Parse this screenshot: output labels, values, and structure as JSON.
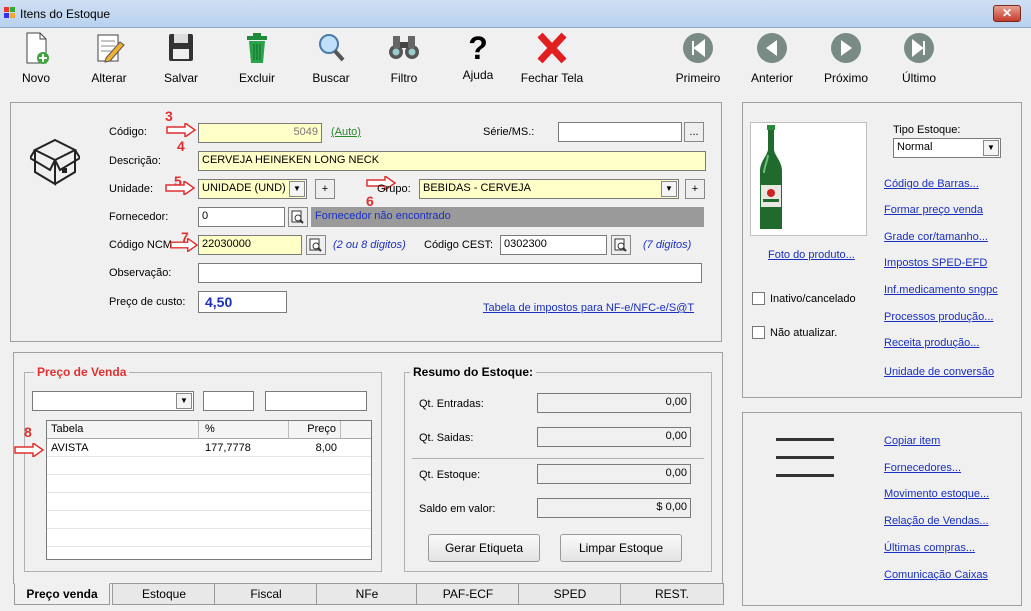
{
  "window": {
    "title": "Itens do Estoque",
    "close": "✕"
  },
  "toolbar": {
    "novo": "Novo",
    "alterar": "Alterar",
    "salvar": "Salvar",
    "excluir": "Excluir",
    "buscar": "Buscar",
    "filtro": "Filtro",
    "ajuda": "Ajuda",
    "fechar": "Fechar Tela",
    "primeiro": "Primeiro",
    "anterior": "Anterior",
    "proximo": "Próximo",
    "ultimo": "Último"
  },
  "form": {
    "codigo_label": "Código:",
    "codigo_value": "5049",
    "codigo_auto": "(Auto)",
    "serie_label": "Série/MS.:",
    "serie_btn": "...",
    "descricao_label": "Descrição:",
    "descricao_value": "CERVEJA HEINEKEN LONG NECK",
    "unidade_label": "Unidade:",
    "unidade_value": "UNIDADE (UND)",
    "grupo_label": "Grupo:",
    "grupo_value": "BEBIDAS - CERVEJA",
    "plus": "+",
    "fornecedor_label": "Fornecedor:",
    "fornecedor_value": "0",
    "fornecedor_status": "Fornecedor não encontrado",
    "ncm_label": "Código NCM:",
    "ncm_value": "22030000",
    "ncm_hint": "(2 ou 8 digitos)",
    "cest_label": "Código CEST:",
    "cest_value": "0302300",
    "cest_hint": "(7 digitos)",
    "obs_label": "Observação:",
    "obs_value": "",
    "custo_label": "Preço de custo:",
    "custo_value": "4,50",
    "tabela_impostos": "Tabela de impostos para NF-e/NFC-e/S@T"
  },
  "annotations": {
    "n3": "3",
    "n4": "4",
    "n5": "5",
    "n6": "6",
    "n7": "7",
    "n8": "8"
  },
  "right_panel": {
    "foto_link": "Foto do produto...",
    "tipo_estoque_label": "Tipo Estoque:",
    "tipo_estoque_value": "Normal",
    "links": [
      "Código de Barras...",
      "Formar preço venda",
      "Grade cor/tamanho...",
      "Impostos SPED-EFD",
      "Inf.medicamento sngpc",
      "Processos produção...",
      "Receita produção...",
      "Unidade de conversão"
    ],
    "inativo": "Inativo/cancelado",
    "nao_atualizar": "Não atualizar.",
    "links2": [
      "Copiar item",
      "Fornecedores...",
      "Movimento estoque...",
      "Relação de Vendas...",
      "Últimas compras...",
      "Comunicação Caixas"
    ]
  },
  "preco_venda": {
    "title": "Preço de Venda",
    "columns": [
      "Tabela",
      "%",
      "Preço"
    ],
    "rows": [
      {
        "tabela": "AVISTA",
        "pct": "177,7778",
        "preco": "8,00"
      }
    ]
  },
  "resumo": {
    "title": "Resumo do Estoque:",
    "entradas_label": "Qt. Entradas:",
    "entradas": "0,00",
    "saidas_label": "Qt. Saidas:",
    "saidas": "0,00",
    "estoque_label": "Qt. Estoque:",
    "estoque": "0,00",
    "saldo_label": "Saldo em valor:",
    "saldo": "$ 0,00",
    "gerar": "Gerar Etiqueta",
    "limpar": "Limpar Estoque"
  },
  "tabs": [
    "Preço venda",
    "Estoque",
    "Fiscal",
    "NFe",
    "PAF-ECF",
    "SPED",
    "REST."
  ]
}
